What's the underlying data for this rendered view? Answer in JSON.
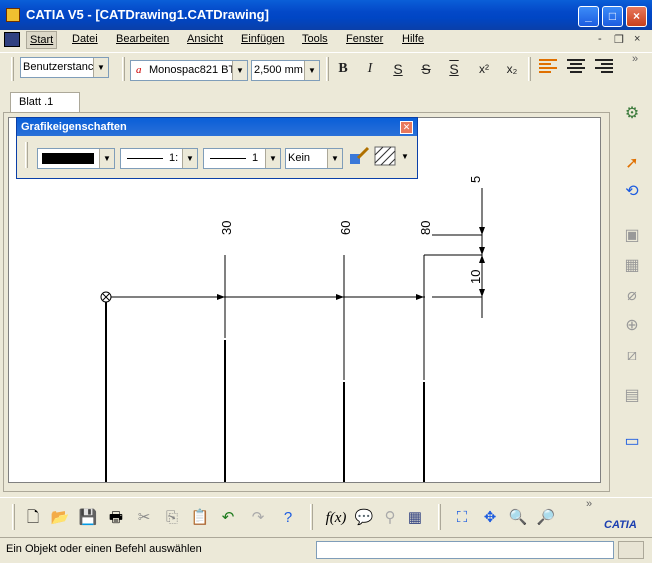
{
  "window": {
    "title": "CATIA V5 - [CATDrawing1.CATDrawing]",
    "min_glyph": "_",
    "max_glyph": "□",
    "close_glyph": "×"
  },
  "menu": {
    "items": [
      "Start",
      "Datei",
      "Bearbeiten",
      "Ansicht",
      "Einfügen",
      "Tools",
      "Fenster",
      "Hilfe"
    ],
    "active": "Start",
    "mdi_controls": [
      "-",
      "❐",
      "×"
    ]
  },
  "toolbar": {
    "style_combo": "Benutzerstanc",
    "font_combo": "Monospac821 BT",
    "size_combo": "2,500 mm",
    "buttons": [
      "B",
      "I",
      "S",
      "S",
      "S",
      "x²",
      "x₂"
    ]
  },
  "sheet_tab": {
    "label": "Blatt .1"
  },
  "graphic_panel": {
    "title": "Grafikeigenschaften",
    "line_weight_value": "1:",
    "line_type_value": "1",
    "fill_value": "Kein"
  },
  "drawing": {
    "dimension_labels": [
      "30",
      "60",
      "80",
      "5",
      "10"
    ]
  },
  "status": {
    "message": "Ein Objekt oder einen Befehl auswählen",
    "input_value": ""
  },
  "logo_text": "CATIA",
  "icons": {
    "right": [
      "wizard-icon",
      "select-icon",
      "rotate-icon",
      "view-icon",
      "hatch-icon",
      "cut-icon",
      "detail-icon",
      "broken-icon",
      "annotation-icon",
      "frame-icon"
    ],
    "bottom": [
      "new-icon",
      "open-icon",
      "save-icon",
      "print-icon",
      "cut-icon",
      "copy-icon",
      "paste-icon",
      "undo-icon",
      "redo-icon",
      "help-icon",
      "formula-icon",
      "comment-icon",
      "knowledge-icon",
      "table-icon",
      "fit-all-icon",
      "pan-icon",
      "zoom-in-icon",
      "zoom-out-icon"
    ]
  }
}
